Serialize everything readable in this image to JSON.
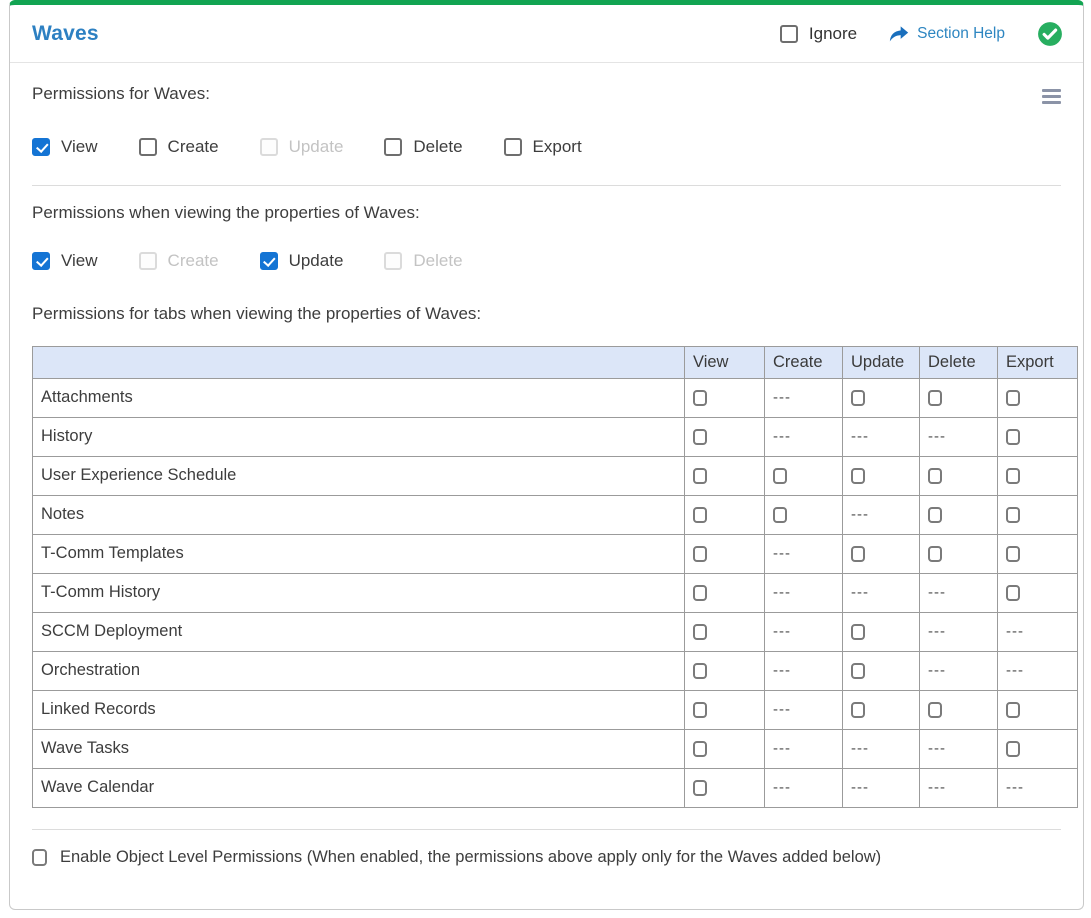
{
  "colors": {
    "accent_green": "#12a452",
    "check_circle_green": "#27ae60",
    "title_blue": "#2d80c2",
    "link_blue": "#2e86c1",
    "checkbox_blue": "#1474d4",
    "table_header_bg": "#dce6f8"
  },
  "header": {
    "title": "Waves",
    "ignore_label": "Ignore",
    "section_help_label": "Section Help"
  },
  "permissions_main": {
    "label": "Permissions for Waves:",
    "options": [
      {
        "label": "View",
        "state": "checked"
      },
      {
        "label": "Create",
        "state": "unchecked"
      },
      {
        "label": "Update",
        "state": "disabled"
      },
      {
        "label": "Delete",
        "state": "unchecked"
      },
      {
        "label": "Export",
        "state": "unchecked"
      }
    ]
  },
  "permissions_properties": {
    "label": "Permissions when viewing the properties of Waves:",
    "options": [
      {
        "label": "View",
        "state": "checked"
      },
      {
        "label": "Create",
        "state": "disabled"
      },
      {
        "label": "Update",
        "state": "checked"
      },
      {
        "label": "Delete",
        "state": "disabled"
      }
    ]
  },
  "tabs_table": {
    "label": "Permissions for tabs when viewing the properties of Waves:",
    "columns": [
      "View",
      "Create",
      "Update",
      "Delete",
      "Export"
    ],
    "empty_cell": "---",
    "rows": [
      {
        "name": "Attachments",
        "cells": [
          "unchecked",
          "dash",
          "unchecked",
          "unchecked",
          "unchecked"
        ]
      },
      {
        "name": "History",
        "cells": [
          "unchecked",
          "dash",
          "dash",
          "dash",
          "unchecked"
        ]
      },
      {
        "name": "User Experience Schedule",
        "cells": [
          "unchecked",
          "unchecked",
          "unchecked",
          "unchecked",
          "unchecked"
        ]
      },
      {
        "name": "Notes",
        "cells": [
          "unchecked",
          "unchecked",
          "dash",
          "unchecked",
          "unchecked"
        ]
      },
      {
        "name": "T-Comm Templates",
        "cells": [
          "unchecked",
          "dash",
          "unchecked",
          "unchecked",
          "unchecked"
        ]
      },
      {
        "name": "T-Comm History",
        "cells": [
          "unchecked",
          "dash",
          "dash",
          "dash",
          "unchecked"
        ]
      },
      {
        "name": "SCCM Deployment",
        "cells": [
          "unchecked",
          "dash",
          "unchecked",
          "dash",
          "dash"
        ]
      },
      {
        "name": "Orchestration",
        "cells": [
          "unchecked",
          "dash",
          "unchecked",
          "dash",
          "dash"
        ]
      },
      {
        "name": "Linked Records",
        "cells": [
          "unchecked",
          "dash",
          "unchecked",
          "unchecked",
          "unchecked"
        ]
      },
      {
        "name": "Wave Tasks",
        "cells": [
          "unchecked",
          "dash",
          "dash",
          "dash",
          "unchecked"
        ]
      },
      {
        "name": "Wave Calendar",
        "cells": [
          "unchecked",
          "dash",
          "dash",
          "dash",
          "dash"
        ]
      }
    ]
  },
  "object_level": {
    "label": "Enable Object Level Permissions (When enabled, the permissions above apply only for the Waves added below)",
    "state": "unchecked"
  }
}
